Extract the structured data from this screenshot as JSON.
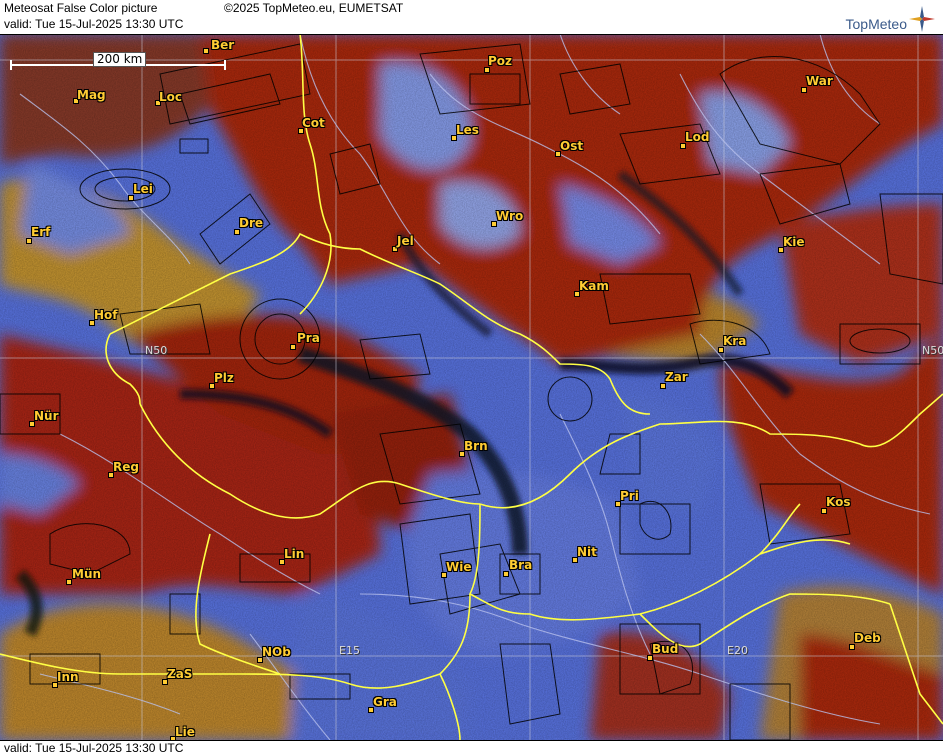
{
  "header": {
    "product": "Meteosat False Color picture",
    "copyright": "©2025 TopMeteo.eu, EUMETSAT",
    "valid": "valid:  Tue  15-Jul-2025  13:30 UTC",
    "brand": "TopMeteo"
  },
  "footer": {
    "valid": "valid:  Tue  15-Jul-2025  13:30 UTC"
  },
  "scale": {
    "label": "200 km"
  },
  "grid_labels": {
    "n50_left": "N50",
    "n50_right": "N50",
    "e15": "E15",
    "e20": "E20"
  },
  "cities": {
    "ber": "Ber",
    "mag": "Mag",
    "loc": "Loc",
    "cot": "Cot",
    "poz": "Poz",
    "war": "War",
    "les": "Les",
    "ost": "Ost",
    "lod": "Lod",
    "lei": "Lei",
    "dre": "Dre",
    "erf": "Erf",
    "wro": "Wro",
    "jel": "Jel",
    "kie": "Kie",
    "kam": "Kam",
    "hof": "Hof",
    "pra": "Pra",
    "kra": "Kra",
    "plz": "Plz",
    "zar": "Zar",
    "nur": "Nür",
    "brn": "Brn",
    "reg": "Reg",
    "kos": "Kos",
    "pri": "Pri",
    "lin": "Lin",
    "nit": "Nit",
    "mun": "Mün",
    "wie": "Wie",
    "bra": "Bra",
    "deb": "Deb",
    "nob": "NOb",
    "bud": "Bud",
    "inn": "Inn",
    "zas": "ZaS",
    "gra": "Gra",
    "lie": "Lie"
  },
  "colors": {
    "cloud_high": "#b52a12",
    "cloud_mid": "#c89a30",
    "clear_ground": "#5a78ee",
    "shadow": "#101528",
    "border": "#ffff44",
    "city_label": "#ffcc33"
  }
}
